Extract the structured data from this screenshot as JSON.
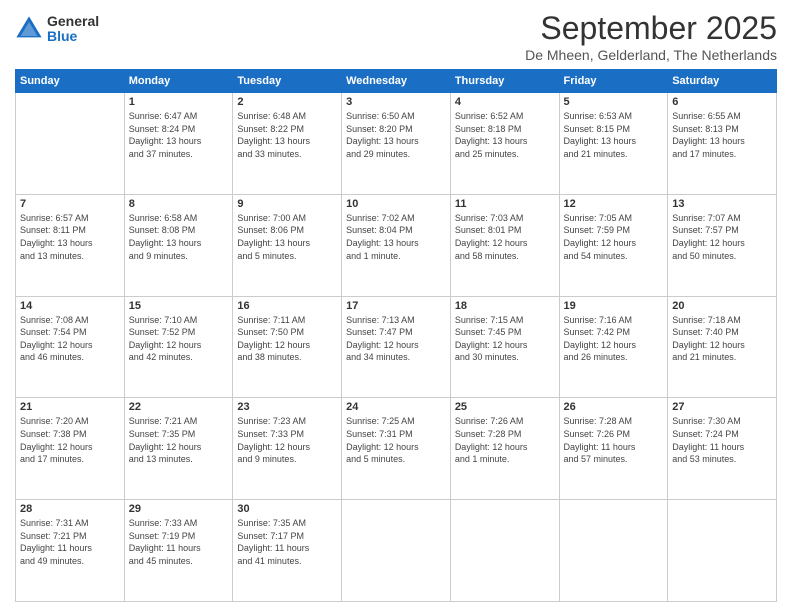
{
  "logo": {
    "general": "General",
    "blue": "Blue"
  },
  "header": {
    "month": "September 2025",
    "location": "De Mheen, Gelderland, The Netherlands"
  },
  "weekdays": [
    "Sunday",
    "Monday",
    "Tuesday",
    "Wednesday",
    "Thursday",
    "Friday",
    "Saturday"
  ],
  "weeks": [
    [
      {
        "day": "",
        "info": ""
      },
      {
        "day": "1",
        "info": "Sunrise: 6:47 AM\nSunset: 8:24 PM\nDaylight: 13 hours\nand 37 minutes."
      },
      {
        "day": "2",
        "info": "Sunrise: 6:48 AM\nSunset: 8:22 PM\nDaylight: 13 hours\nand 33 minutes."
      },
      {
        "day": "3",
        "info": "Sunrise: 6:50 AM\nSunset: 8:20 PM\nDaylight: 13 hours\nand 29 minutes."
      },
      {
        "day": "4",
        "info": "Sunrise: 6:52 AM\nSunset: 8:18 PM\nDaylight: 13 hours\nand 25 minutes."
      },
      {
        "day": "5",
        "info": "Sunrise: 6:53 AM\nSunset: 8:15 PM\nDaylight: 13 hours\nand 21 minutes."
      },
      {
        "day": "6",
        "info": "Sunrise: 6:55 AM\nSunset: 8:13 PM\nDaylight: 13 hours\nand 17 minutes."
      }
    ],
    [
      {
        "day": "7",
        "info": "Sunrise: 6:57 AM\nSunset: 8:11 PM\nDaylight: 13 hours\nand 13 minutes."
      },
      {
        "day": "8",
        "info": "Sunrise: 6:58 AM\nSunset: 8:08 PM\nDaylight: 13 hours\nand 9 minutes."
      },
      {
        "day": "9",
        "info": "Sunrise: 7:00 AM\nSunset: 8:06 PM\nDaylight: 13 hours\nand 5 minutes."
      },
      {
        "day": "10",
        "info": "Sunrise: 7:02 AM\nSunset: 8:04 PM\nDaylight: 13 hours\nand 1 minute."
      },
      {
        "day": "11",
        "info": "Sunrise: 7:03 AM\nSunset: 8:01 PM\nDaylight: 12 hours\nand 58 minutes."
      },
      {
        "day": "12",
        "info": "Sunrise: 7:05 AM\nSunset: 7:59 PM\nDaylight: 12 hours\nand 54 minutes."
      },
      {
        "day": "13",
        "info": "Sunrise: 7:07 AM\nSunset: 7:57 PM\nDaylight: 12 hours\nand 50 minutes."
      }
    ],
    [
      {
        "day": "14",
        "info": "Sunrise: 7:08 AM\nSunset: 7:54 PM\nDaylight: 12 hours\nand 46 minutes."
      },
      {
        "day": "15",
        "info": "Sunrise: 7:10 AM\nSunset: 7:52 PM\nDaylight: 12 hours\nand 42 minutes."
      },
      {
        "day": "16",
        "info": "Sunrise: 7:11 AM\nSunset: 7:50 PM\nDaylight: 12 hours\nand 38 minutes."
      },
      {
        "day": "17",
        "info": "Sunrise: 7:13 AM\nSunset: 7:47 PM\nDaylight: 12 hours\nand 34 minutes."
      },
      {
        "day": "18",
        "info": "Sunrise: 7:15 AM\nSunset: 7:45 PM\nDaylight: 12 hours\nand 30 minutes."
      },
      {
        "day": "19",
        "info": "Sunrise: 7:16 AM\nSunset: 7:42 PM\nDaylight: 12 hours\nand 26 minutes."
      },
      {
        "day": "20",
        "info": "Sunrise: 7:18 AM\nSunset: 7:40 PM\nDaylight: 12 hours\nand 21 minutes."
      }
    ],
    [
      {
        "day": "21",
        "info": "Sunrise: 7:20 AM\nSunset: 7:38 PM\nDaylight: 12 hours\nand 17 minutes."
      },
      {
        "day": "22",
        "info": "Sunrise: 7:21 AM\nSunset: 7:35 PM\nDaylight: 12 hours\nand 13 minutes."
      },
      {
        "day": "23",
        "info": "Sunrise: 7:23 AM\nSunset: 7:33 PM\nDaylight: 12 hours\nand 9 minutes."
      },
      {
        "day": "24",
        "info": "Sunrise: 7:25 AM\nSunset: 7:31 PM\nDaylight: 12 hours\nand 5 minutes."
      },
      {
        "day": "25",
        "info": "Sunrise: 7:26 AM\nSunset: 7:28 PM\nDaylight: 12 hours\nand 1 minute."
      },
      {
        "day": "26",
        "info": "Sunrise: 7:28 AM\nSunset: 7:26 PM\nDaylight: 11 hours\nand 57 minutes."
      },
      {
        "day": "27",
        "info": "Sunrise: 7:30 AM\nSunset: 7:24 PM\nDaylight: 11 hours\nand 53 minutes."
      }
    ],
    [
      {
        "day": "28",
        "info": "Sunrise: 7:31 AM\nSunset: 7:21 PM\nDaylight: 11 hours\nand 49 minutes."
      },
      {
        "day": "29",
        "info": "Sunrise: 7:33 AM\nSunset: 7:19 PM\nDaylight: 11 hours\nand 45 minutes."
      },
      {
        "day": "30",
        "info": "Sunrise: 7:35 AM\nSunset: 7:17 PM\nDaylight: 11 hours\nand 41 minutes."
      },
      {
        "day": "",
        "info": ""
      },
      {
        "day": "",
        "info": ""
      },
      {
        "day": "",
        "info": ""
      },
      {
        "day": "",
        "info": ""
      }
    ]
  ]
}
